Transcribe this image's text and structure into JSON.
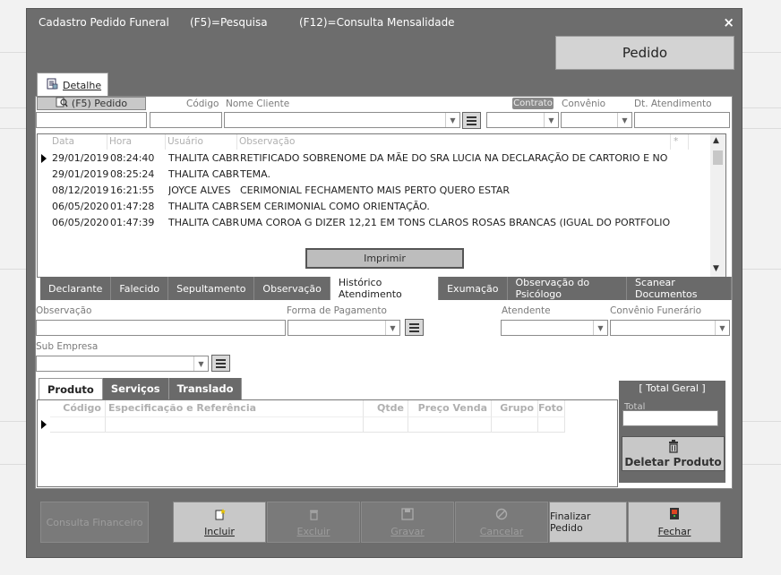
{
  "window": {
    "title": "Cadastro Pedido Funeral",
    "hint_f5": "(F5)=Pesquisa",
    "hint_f12": "(F12)=Consulta Mensalidade",
    "close": "×"
  },
  "pedido_button": "Pedido",
  "main_tab": "Detalhe",
  "header_fields": {
    "f5_pedido": "(F5) Pedido",
    "codigo": "Código",
    "nome_cliente": "Nome Cliente",
    "contrato": "Contrato",
    "convenio": "Convênio",
    "dt_atendimento": "Dt. Atendimento"
  },
  "history_grid": {
    "columns": [
      "Data",
      "Hora",
      "Usuário",
      "Observação",
      "*"
    ],
    "rows": [
      {
        "data": "29/01/2019",
        "hora": "08:24:40",
        "usuario": "THALITA CABR",
        "obs": "RETIFICADO SOBRENOME DA MÃE DO SRA LUCIA NA DECLARAÇÃO DE CARTORIO E NO SIS-"
      },
      {
        "data": "29/01/2019",
        "hora": "08:25:24",
        "usuario": "THALITA CABR",
        "obs": "TEMA."
      },
      {
        "data": "08/12/2019",
        "hora": "16:21:55",
        "usuario": "JOYCE ALVES",
        "obs": "CERIMONIAL FECHAMENTO MAIS PERTO QUERO ESTAR"
      },
      {
        "data": "06/05/2020",
        "hora": "01:47:28",
        "usuario": "THALITA CABR",
        "obs": "SEM CERIMONIAL COMO ORIENTAÇÃO."
      },
      {
        "data": "06/05/2020",
        "hora": "01:47:39",
        "usuario": "THALITA CABR",
        "obs": "UMA COROA G DIZER 12,21 EM TONS CLAROS ROSAS BRANCAS (IGUAL DO PORTFOLIO)"
      }
    ]
  },
  "imprimir": "Imprimir",
  "section_tabs": [
    "Declarante",
    "Falecido",
    "Sepultamento",
    "Observação",
    "Histórico Atendimento",
    "Exumação",
    "Observação do Psicólogo",
    "Scanear Documentos"
  ],
  "form_labels": {
    "observacao": "Observação",
    "forma_pagamento": "Forma de Pagamento",
    "atendente": "Atendente",
    "convenio_funerario": "Convênio Funerário",
    "sub_empresa": "Sub Empresa"
  },
  "product_tabs": [
    "Produto",
    "Serviços",
    "Translado"
  ],
  "product_grid": {
    "columns": [
      "Código",
      "Especificação e Referência",
      "Qtde",
      "Preço Venda",
      "Grupo",
      "Foto"
    ]
  },
  "total": {
    "title": "[ Total Geral ]",
    "label": "Total",
    "delete": "Deletar Produto"
  },
  "footer_buttons": {
    "consulta_financeiro": "Consulta Financeiro",
    "incluir": "Incluir",
    "excluir": "Excluir",
    "gravar": "Gravar",
    "cancelar": "Cancelar",
    "finalizar": "Finalizar Pedido",
    "fechar": "Fechar"
  }
}
